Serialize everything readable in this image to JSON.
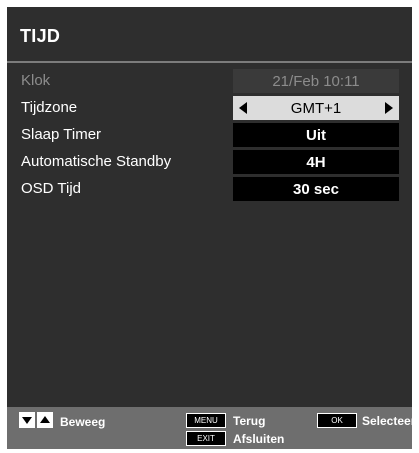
{
  "menu": {
    "title": "TIJD",
    "rows": [
      {
        "label": "Klok",
        "value": "21/Feb  10:11"
      },
      {
        "label": "Tijdzone",
        "value": "GMT+1"
      },
      {
        "label": "Slaap Timer",
        "value": "Uit"
      },
      {
        "label": "Automatische Standby",
        "value": "4H"
      },
      {
        "label": "OSD Tijd",
        "value": "30 sec"
      }
    ]
  },
  "footer": {
    "move_label": "Beweeg",
    "menu_key": "MENU",
    "back_label": "Terug",
    "exit_key": "EXIT",
    "exit_label": "Afsluiten",
    "ok_key": "OK",
    "select_label": "Selecteer"
  }
}
